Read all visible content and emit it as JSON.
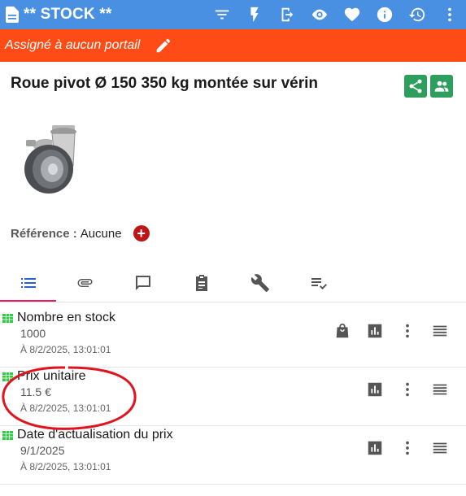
{
  "app": {
    "title": "** STOCK **",
    "toolbar_icons": [
      "filter-icon",
      "flash-icon",
      "exit-icon",
      "eye-icon",
      "heart-icon",
      "info-icon",
      "history-icon",
      "more-vert-icon"
    ]
  },
  "banner": {
    "text": "Assigné à aucun portail",
    "color": "#ff4c17"
  },
  "product": {
    "title": "Roue pivot Ø 150 350 kg montée sur vérin",
    "reference_label": "Référence :",
    "reference_value": "Aucune"
  },
  "tabs": [
    {
      "icon": "list-icon",
      "active": true
    },
    {
      "icon": "attachment-icon",
      "active": false
    },
    {
      "icon": "comment-icon",
      "active": false
    },
    {
      "icon": "clipboard-icon",
      "active": false
    },
    {
      "icon": "wrench-icon",
      "active": false
    },
    {
      "icon": "checklist-icon",
      "active": false
    }
  ],
  "rows": [
    {
      "name": "Nombre en stock",
      "value": "1000",
      "time": "À 8/2/2025, 13:01:01"
    },
    {
      "name": "Prix unitaire",
      "value": "11.5 €",
      "time": "À 8/2/2025, 13:01:01"
    },
    {
      "name": "Date d'actualisation du prix",
      "value": "9/1/2025",
      "time": "À 8/2/2025, 13:01:01"
    }
  ],
  "colors": {
    "appbar": "#4a90e2",
    "accent_green": "#2e9e5e",
    "tab_active": "#2a62c9",
    "tab_indicator": "#e91e63",
    "annotation": "#e0141e"
  }
}
